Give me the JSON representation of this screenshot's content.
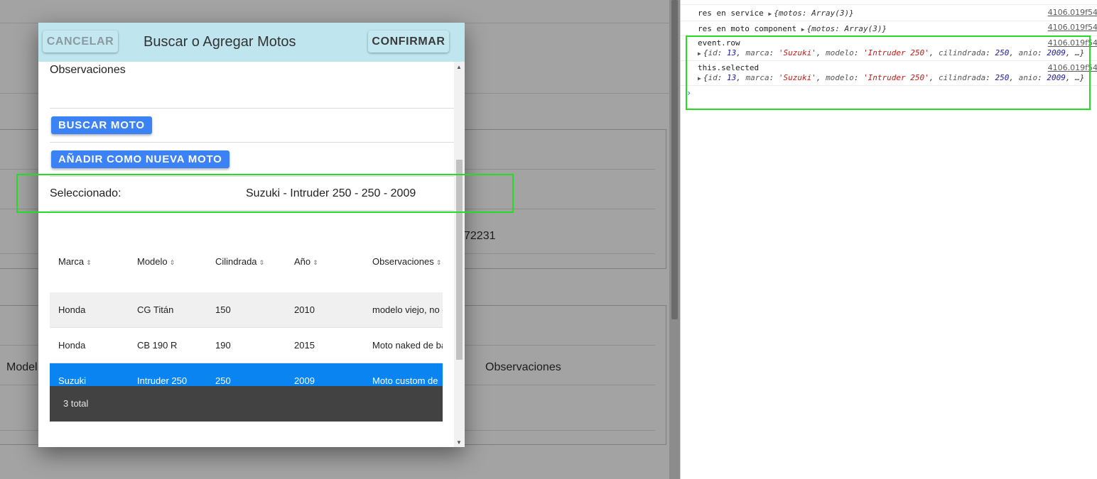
{
  "background_page": {
    "partial_number": "72231",
    "col_model": "Model",
    "col_observaciones": "Observaciones"
  },
  "modal": {
    "title": "Buscar o Agregar Motos",
    "cancel_label": "CANCELAR",
    "confirm_label": "CONFIRMAR",
    "observaciones_label": "Observaciones",
    "buscar_button": "BUSCAR MOTO",
    "anadir_button": "AÑADIR COMO NUEVA MOTO",
    "selected_label": "Seleccionado:",
    "selected_value": "Suzuki - Intruder 250 - 250 - 2009",
    "table": {
      "headers": [
        "Marca",
        "Modelo",
        "Cilindrada",
        "Año",
        "Observaciones"
      ],
      "rows": [
        {
          "marca": "Honda",
          "modelo": "CG Titán",
          "cilindrada": "150",
          "anio": "2010",
          "obs": "modelo viejo, no c"
        },
        {
          "marca": "Honda",
          "modelo": "CB 190 R",
          "cilindrada": "190",
          "anio": "2015",
          "obs": "Moto naked de ba"
        },
        {
          "marca": "Suzuki",
          "modelo": "Intruder 250",
          "cilindrada": "250",
          "anio": "2009",
          "obs": "Moto custom de"
        }
      ],
      "selected_row_index": 2,
      "footer": "3 total"
    }
  },
  "console": {
    "lines": [
      {
        "label": "res en service",
        "obj": "{motos: Array(3)}",
        "src": "4106.019f54"
      },
      {
        "label": "res en moto component",
        "obj": "{motos: Array(3)}",
        "src": "4106.019f54"
      },
      {
        "label": "event.row",
        "src": "4106.019f54"
      },
      {
        "label": "this.selected",
        "src": "4106.019f54"
      }
    ],
    "selected_obj": {
      "id": "13",
      "marca": "'Suzuki'",
      "modelo": "'Intruder 250'",
      "cilindrada": "250",
      "anio": "2009"
    }
  },
  "colors": {
    "modal_header": "#bfe6ef",
    "primary_button": "#3b82f6",
    "selected_row": "#0a84f0",
    "highlight": "#22dd22",
    "footer": "#424242"
  }
}
